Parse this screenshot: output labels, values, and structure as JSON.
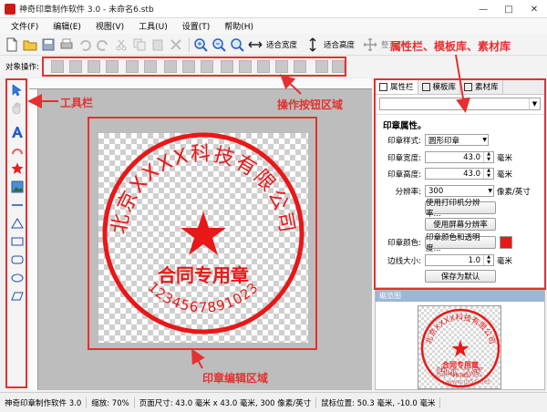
{
  "window": {
    "title": "神奇印章制作软件 3.0 - 未命名6.stb",
    "controls": [
      "—",
      "□",
      "✕"
    ]
  },
  "menu": [
    "文件(F)",
    "编辑(E)",
    "视图(V)",
    "工具(U)",
    "设置(T)",
    "帮助(H)"
  ],
  "toolbar": {
    "fit_width": "适合宽度",
    "fit_height": "适合高度",
    "whole_page": "整页显示"
  },
  "object_ops_label": "对象操作:",
  "annotations": {
    "toolbar_area": "工具栏",
    "ops_area": "操作按钮区域",
    "panels_area": "属性栏、模板库、素材库",
    "edit_area": "印章编辑区域"
  },
  "panel": {
    "tabs": [
      "属性栏",
      "模板库",
      "素材库"
    ],
    "heading": "印章属性。",
    "style_label": "印章样式:",
    "style_value": "圆形印章",
    "width_label": "印章宽度:",
    "width_value": "43.0",
    "height_label": "印章高度:",
    "height_value": "43.0",
    "unit_mm": "毫米",
    "resolution_label": "分辨率:",
    "resolution_value": "300",
    "resolution_unit": "像素/英寸",
    "btn_printer_res": "使用打印机分辨率...",
    "btn_screen_res": "使用屏幕分辨率",
    "color_label": "印章颜色:",
    "btn_color": "印章颜色和透明度...",
    "color_value": "#e81818",
    "border_label": "边线大小:",
    "border_value": "1.0",
    "btn_save_default": "保存为默认"
  },
  "preview": {
    "title": "缩览图"
  },
  "seal": {
    "top_text": "北京XXXX科技有限公司",
    "center_text": "合同专用章",
    "bottom_text": "1234567891023",
    "color": "#e81818"
  },
  "watermark": {
    "text": "脚本之家",
    "url": "www.jb51.net"
  },
  "status": {
    "app": "神奇印章制作软件 3.0",
    "zoom": "缩放: 70%",
    "page": "页面尺寸: 43.0 毫米 x 43.0 毫米, 300 像素/英寸",
    "mouse": "鼠标位置: 50.3 毫米, -10.0 毫米"
  }
}
